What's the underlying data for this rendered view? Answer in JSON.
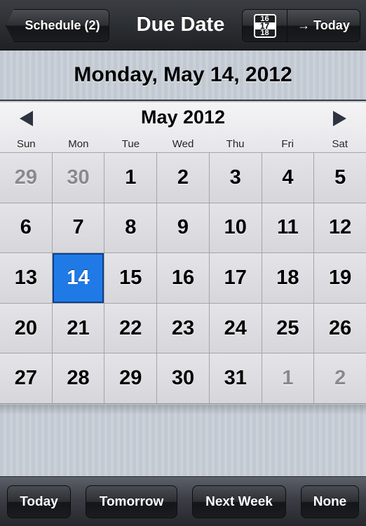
{
  "navbar": {
    "back_label": "Schedule (2)",
    "title": "Due Date",
    "calendar_icon": {
      "top": "16",
      "mid": "17",
      "bottom": "18"
    },
    "today_label": "→ Today"
  },
  "selected_date_text": "Monday, May 14, 2012",
  "calendar": {
    "month_label": "May 2012",
    "prev_icon": "triangle-left",
    "next_icon": "triangle-right",
    "weekdays": [
      "Sun",
      "Mon",
      "Tue",
      "Wed",
      "Thu",
      "Fri",
      "Sat"
    ],
    "selected_day": "14",
    "weeks": [
      [
        {
          "d": "29",
          "other": true
        },
        {
          "d": "30",
          "other": true
        },
        {
          "d": "1"
        },
        {
          "d": "2"
        },
        {
          "d": "3"
        },
        {
          "d": "4"
        },
        {
          "d": "5"
        }
      ],
      [
        {
          "d": "6"
        },
        {
          "d": "7"
        },
        {
          "d": "8"
        },
        {
          "d": "9"
        },
        {
          "d": "10"
        },
        {
          "d": "11"
        },
        {
          "d": "12"
        }
      ],
      [
        {
          "d": "13"
        },
        {
          "d": "14",
          "selected": true
        },
        {
          "d": "15"
        },
        {
          "d": "16"
        },
        {
          "d": "17"
        },
        {
          "d": "18"
        },
        {
          "d": "19"
        }
      ],
      [
        {
          "d": "20"
        },
        {
          "d": "21"
        },
        {
          "d": "22"
        },
        {
          "d": "23"
        },
        {
          "d": "24"
        },
        {
          "d": "25"
        },
        {
          "d": "26"
        }
      ],
      [
        {
          "d": "27"
        },
        {
          "d": "28"
        },
        {
          "d": "29"
        },
        {
          "d": "30"
        },
        {
          "d": "31"
        },
        {
          "d": "1",
          "other": true
        },
        {
          "d": "2",
          "other": true
        }
      ]
    ]
  },
  "toolbar": {
    "buttons": [
      "Today",
      "Tomorrow",
      "Next Week",
      "None"
    ]
  },
  "colors": {
    "selected": "#1f7ae6",
    "other_month_text": "#8a8a8e"
  }
}
